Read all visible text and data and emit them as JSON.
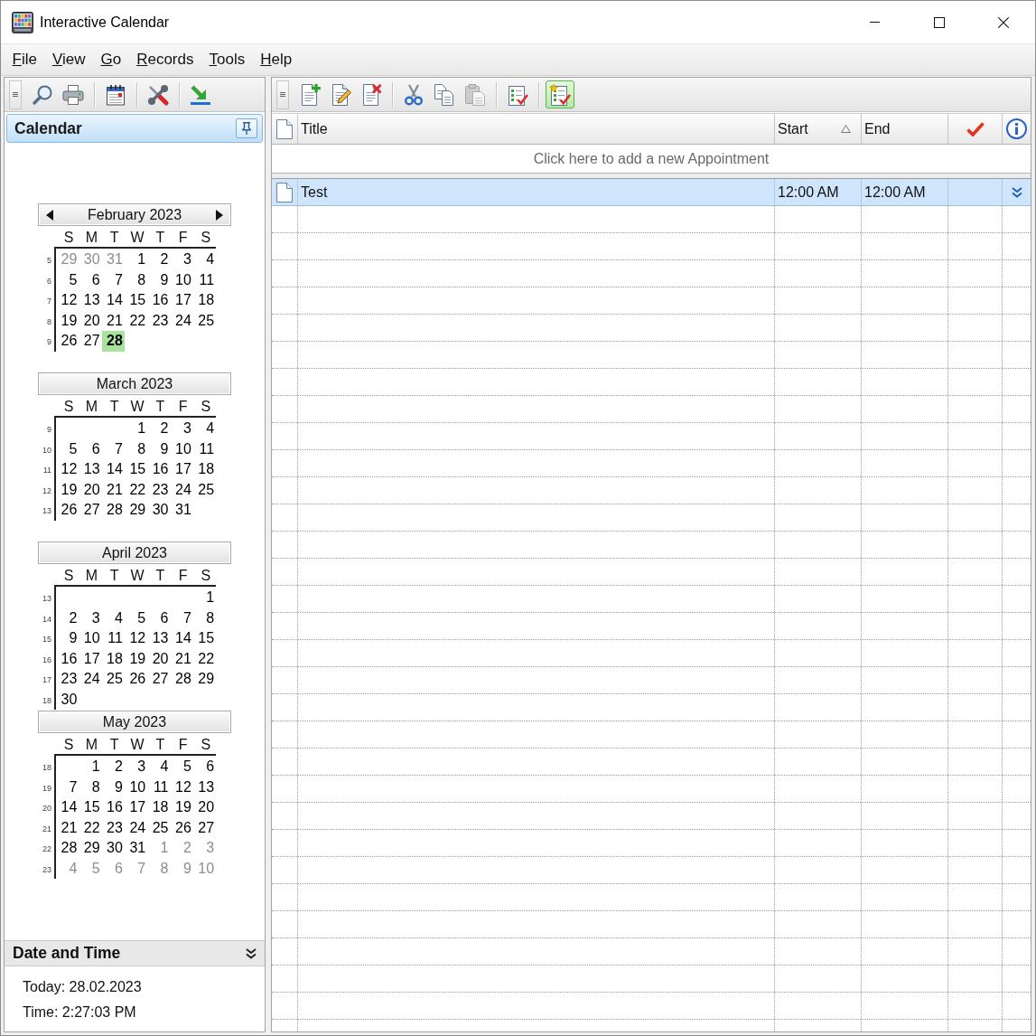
{
  "window": {
    "title": "Interactive Calendar"
  },
  "menu": [
    "File",
    "View",
    "Go",
    "Records",
    "Tools",
    "Help"
  ],
  "navigator_toolbar": {
    "groups": [
      [
        {
          "kind": "search"
        },
        {
          "kind": "print"
        }
      ],
      [
        {
          "kind": "calendar"
        }
      ],
      [
        {
          "kind": "tools"
        }
      ],
      [
        {
          "kind": "export"
        }
      ]
    ]
  },
  "navigator": {
    "title": "Calendar",
    "months": [
      {
        "title": "February 2023",
        "navigation": true,
        "weekdays": [
          "S",
          "M",
          "T",
          "W",
          "T",
          "F",
          "S"
        ],
        "weeks": [
          {
            "number": "5",
            "days": [
              {
                "day": "29",
                "other_month": true,
                "selected": false
              },
              {
                "day": "30",
                "other_month": true,
                "selected": false
              },
              {
                "day": "31",
                "other_month": true,
                "selected": false
              },
              {
                "day": "1",
                "other_month": false,
                "selected": false
              },
              {
                "day": "2",
                "other_month": false,
                "selected": false
              },
              {
                "day": "3",
                "other_month": false,
                "selected": false
              },
              {
                "day": "4",
                "other_month": false,
                "selected": false
              }
            ]
          },
          {
            "number": "6",
            "days": [
              {
                "day": "5",
                "other_month": false,
                "selected": false
              },
              {
                "day": "6",
                "other_month": false,
                "selected": false
              },
              {
                "day": "7",
                "other_month": false,
                "selected": false
              },
              {
                "day": "8",
                "other_month": false,
                "selected": false
              },
              {
                "day": "9",
                "other_month": false,
                "selected": false
              },
              {
                "day": "10",
                "other_month": false,
                "selected": false
              },
              {
                "day": "11",
                "other_month": false,
                "selected": false
              }
            ]
          },
          {
            "number": "7",
            "days": [
              {
                "day": "12",
                "other_month": false,
                "selected": false
              },
              {
                "day": "13",
                "other_month": false,
                "selected": false
              },
              {
                "day": "14",
                "other_month": false,
                "selected": false
              },
              {
                "day": "15",
                "other_month": false,
                "selected": false
              },
              {
                "day": "16",
                "other_month": false,
                "selected": false
              },
              {
                "day": "17",
                "other_month": false,
                "selected": false
              },
              {
                "day": "18",
                "other_month": false,
                "selected": false
              }
            ]
          },
          {
            "number": "8",
            "days": [
              {
                "day": "19",
                "other_month": false,
                "selected": false
              },
              {
                "day": "20",
                "other_month": false,
                "selected": false
              },
              {
                "day": "21",
                "other_month": false,
                "selected": false
              },
              {
                "day": "22",
                "other_month": false,
                "selected": false
              },
              {
                "day": "23",
                "other_month": false,
                "selected": false
              },
              {
                "day": "24",
                "other_month": false,
                "selected": false
              },
              {
                "day": "25",
                "other_month": false,
                "selected": false
              }
            ]
          },
          {
            "number": "9",
            "days": [
              {
                "day": "26",
                "other_month": false,
                "selected": false
              },
              {
                "day": "27",
                "other_month": false,
                "selected": false
              },
              {
                "day": "28",
                "other_month": false,
                "selected": true
              }
            ]
          }
        ]
      },
      {
        "title": "March 2023",
        "navigation": false,
        "weekdays": [
          "S",
          "M",
          "T",
          "W",
          "T",
          "F",
          "S"
        ],
        "weeks": [
          {
            "number": "9",
            "days": [
              {
                "day": "1",
                "other_month": false,
                "selected": false
              },
              {
                "day": "2",
                "other_month": false,
                "selected": false
              },
              {
                "day": "3",
                "other_month": false,
                "selected": false
              },
              {
                "day": "4",
                "other_month": false,
                "selected": false
              }
            ]
          },
          {
            "number": "10",
            "days": [
              {
                "day": "5",
                "other_month": false,
                "selected": false
              },
              {
                "day": "6",
                "other_month": false,
                "selected": false
              },
              {
                "day": "7",
                "other_month": false,
                "selected": false
              },
              {
                "day": "8",
                "other_month": false,
                "selected": false
              },
              {
                "day": "9",
                "other_month": false,
                "selected": false
              },
              {
                "day": "10",
                "other_month": false,
                "selected": false
              },
              {
                "day": "11",
                "other_month": false,
                "selected": false
              }
            ]
          },
          {
            "number": "11",
            "days": [
              {
                "day": "12",
                "other_month": false,
                "selected": false
              },
              {
                "day": "13",
                "other_month": false,
                "selected": false
              },
              {
                "day": "14",
                "other_month": false,
                "selected": false
              },
              {
                "day": "15",
                "other_month": false,
                "selected": false
              },
              {
                "day": "16",
                "other_month": false,
                "selected": false
              },
              {
                "day": "17",
                "other_month": false,
                "selected": false
              },
              {
                "day": "18",
                "other_month": false,
                "selected": false
              }
            ]
          },
          {
            "number": "12",
            "days": [
              {
                "day": "19",
                "other_month": false,
                "selected": false
              },
              {
                "day": "20",
                "other_month": false,
                "selected": false
              },
              {
                "day": "21",
                "other_month": false,
                "selected": false
              },
              {
                "day": "22",
                "other_month": false,
                "selected": false
              },
              {
                "day": "23",
                "other_month": false,
                "selected": false
              },
              {
                "day": "24",
                "other_month": false,
                "selected": false
              },
              {
                "day": "25",
                "other_month": false,
                "selected": false
              }
            ]
          },
          {
            "number": "13",
            "days": [
              {
                "day": "26",
                "other_month": false,
                "selected": false
              },
              {
                "day": "27",
                "other_month": false,
                "selected": false
              },
              {
                "day": "28",
                "other_month": false,
                "selected": false
              },
              {
                "day": "29",
                "other_month": false,
                "selected": false
              },
              {
                "day": "30",
                "other_month": false,
                "selected": false
              },
              {
                "day": "31",
                "other_month": false,
                "selected": false
              }
            ]
          }
        ]
      },
      {
        "title": "April 2023",
        "navigation": false,
        "weekdays": [
          "S",
          "M",
          "T",
          "W",
          "T",
          "F",
          "S"
        ],
        "weeks": [
          {
            "number": "13",
            "days": [
              {
                "day": "1",
                "other_month": false,
                "selected": false
              }
            ]
          },
          {
            "number": "14",
            "days": [
              {
                "day": "2",
                "other_month": false,
                "selected": false
              },
              {
                "day": "3",
                "other_month": false,
                "selected": false
              },
              {
                "day": "4",
                "other_month": false,
                "selected": false
              },
              {
                "day": "5",
                "other_month": false,
                "selected": false
              },
              {
                "day": "6",
                "other_month": false,
                "selected": false
              },
              {
                "day": "7",
                "other_month": false,
                "selected": false
              },
              {
                "day": "8",
                "other_month": false,
                "selected": false
              }
            ]
          },
          {
            "number": "15",
            "days": [
              {
                "day": "9",
                "other_month": false,
                "selected": false
              },
              {
                "day": "10",
                "other_month": false,
                "selected": false
              },
              {
                "day": "11",
                "other_month": false,
                "selected": false
              },
              {
                "day": "12",
                "other_month": false,
                "selected": false
              },
              {
                "day": "13",
                "other_month": false,
                "selected": false
              },
              {
                "day": "14",
                "other_month": false,
                "selected": false
              },
              {
                "day": "15",
                "other_month": false,
                "selected": false
              }
            ]
          },
          {
            "number": "16",
            "days": [
              {
                "day": "16",
                "other_month": false,
                "selected": false
              },
              {
                "day": "17",
                "other_month": false,
                "selected": false
              },
              {
                "day": "18",
                "other_month": false,
                "selected": false
              },
              {
                "day": "19",
                "other_month": false,
                "selected": false
              },
              {
                "day": "20",
                "other_month": false,
                "selected": false
              },
              {
                "day": "21",
                "other_month": false,
                "selected": false
              },
              {
                "day": "22",
                "other_month": false,
                "selected": false
              }
            ]
          },
          {
            "number": "17",
            "days": [
              {
                "day": "23",
                "other_month": false,
                "selected": false
              },
              {
                "day": "24",
                "other_month": false,
                "selected": false
              },
              {
                "day": "25",
                "other_month": false,
                "selected": false
              },
              {
                "day": "26",
                "other_month": false,
                "selected": false
              },
              {
                "day": "27",
                "other_month": false,
                "selected": false
              },
              {
                "day": "28",
                "other_month": false,
                "selected": false
              },
              {
                "day": "29",
                "other_month": false,
                "selected": false
              }
            ]
          },
          {
            "number": "18",
            "days": [
              {
                "day": "30",
                "other_month": false,
                "selected": false
              }
            ]
          }
        ]
      },
      {
        "title": "May 2023",
        "navigation": false,
        "weekdays": [
          "S",
          "M",
          "T",
          "W",
          "T",
          "F",
          "S"
        ],
        "weeks": [
          {
            "number": "18",
            "days": [
              {
                "day": "1",
                "other_month": false,
                "selected": false
              },
              {
                "day": "2",
                "other_month": false,
                "selected": false
              },
              {
                "day": "3",
                "other_month": false,
                "selected": false
              },
              {
                "day": "4",
                "other_month": false,
                "selected": false
              },
              {
                "day": "5",
                "other_month": false,
                "selected": false
              },
              {
                "day": "6",
                "other_month": false,
                "selected": false
              }
            ]
          },
          {
            "number": "19",
            "days": [
              {
                "day": "7",
                "other_month": false,
                "selected": false
              },
              {
                "day": "8",
                "other_month": false,
                "selected": false
              },
              {
                "day": "9",
                "other_month": false,
                "selected": false
              },
              {
                "day": "10",
                "other_month": false,
                "selected": false
              },
              {
                "day": "11",
                "other_month": false,
                "selected": false
              },
              {
                "day": "12",
                "other_month": false,
                "selected": false
              },
              {
                "day": "13",
                "other_month": false,
                "selected": false
              }
            ]
          },
          {
            "number": "20",
            "days": [
              {
                "day": "14",
                "other_month": false,
                "selected": false
              },
              {
                "day": "15",
                "other_month": false,
                "selected": false
              },
              {
                "day": "16",
                "other_month": false,
                "selected": false
              },
              {
                "day": "17",
                "other_month": false,
                "selected": false
              },
              {
                "day": "18",
                "other_month": false,
                "selected": false
              },
              {
                "day": "19",
                "other_month": false,
                "selected": false
              },
              {
                "day": "20",
                "other_month": false,
                "selected": false
              }
            ]
          },
          {
            "number": "21",
            "days": [
              {
                "day": "21",
                "other_month": false,
                "selected": false
              },
              {
                "day": "22",
                "other_month": false,
                "selected": false
              },
              {
                "day": "23",
                "other_month": false,
                "selected": false
              },
              {
                "day": "24",
                "other_month": false,
                "selected": false
              },
              {
                "day": "25",
                "other_month": false,
                "selected": false
              },
              {
                "day": "26",
                "other_month": false,
                "selected": false
              },
              {
                "day": "27",
                "other_month": false,
                "selected": false
              }
            ]
          },
          {
            "number": "22",
            "days": [
              {
                "day": "28",
                "other_month": false,
                "selected": false
              },
              {
                "day": "29",
                "other_month": false,
                "selected": false
              },
              {
                "day": "30",
                "other_month": false,
                "selected": false
              },
              {
                "day": "31",
                "other_month": false,
                "selected": false
              },
              {
                "day": "1",
                "other_month": true,
                "selected": false
              },
              {
                "day": "2",
                "other_month": true,
                "selected": false
              },
              {
                "day": "3",
                "other_month": true,
                "selected": false
              }
            ]
          },
          {
            "number": "23",
            "days": [
              {
                "day": "4",
                "other_month": true,
                "selected": false
              },
              {
                "day": "5",
                "other_month": true,
                "selected": false
              },
              {
                "day": "6",
                "other_month": true,
                "selected": false
              },
              {
                "day": "7",
                "other_month": true,
                "selected": false
              },
              {
                "day": "8",
                "other_month": true,
                "selected": false
              },
              {
                "day": "9",
                "other_month": true,
                "selected": false
              },
              {
                "day": "10",
                "other_month": true,
                "selected": false
              }
            ]
          }
        ]
      }
    ]
  },
  "date_time_panel": {
    "title": "Date and Time",
    "lines": [
      "Today: 28.02.2023",
      "Time: 2:27:03 PM"
    ]
  },
  "appointment_toolbar": {
    "groups": [
      [
        {
          "kind": "new",
          "disabled": false,
          "on": false
        },
        {
          "kind": "edit",
          "disabled": false,
          "on": false
        },
        {
          "kind": "delete",
          "disabled": false,
          "on": false
        }
      ],
      [
        {
          "kind": "cut",
          "disabled": false,
          "on": false
        },
        {
          "kind": "copy",
          "disabled": false,
          "on": false
        },
        {
          "kind": "paste",
          "disabled": true,
          "on": false
        }
      ],
      [
        {
          "kind": "tasks",
          "disabled": false,
          "on": false
        }
      ],
      [
        {
          "kind": "starred",
          "disabled": false,
          "on": true
        }
      ]
    ]
  },
  "appointments": {
    "columns": [
      {
        "kind": "type",
        "sorted": false
      },
      {
        "kind": "text",
        "label": "Title",
        "sorted": false
      },
      {
        "kind": "text",
        "label": "Start",
        "sorted": true
      },
      {
        "kind": "text",
        "label": "End",
        "sorted": false
      },
      {
        "kind": "status",
        "sorted": false
      },
      {
        "kind": "info",
        "sorted": false
      }
    ],
    "new_row_prompt": "Click here to add a new Appointment",
    "rows": [
      {
        "selected": true,
        "values": [
          "Test",
          "12:00 AM",
          "12:00 AM"
        ]
      }
    ]
  }
}
